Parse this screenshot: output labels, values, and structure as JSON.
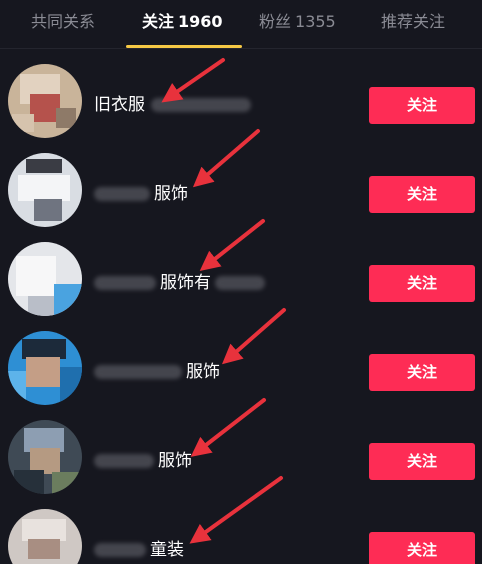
{
  "tabs": [
    {
      "label": "共同关系",
      "count": ""
    },
    {
      "label": "关注",
      "count": "1960"
    },
    {
      "label": "粉丝",
      "count": "1355"
    },
    {
      "label": "推荐关注",
      "count": ""
    }
  ],
  "accent_colors": {
    "follow_button": "#fe2c55",
    "tab_indicator": "#f6c945",
    "arrow": "#e8323c"
  },
  "follow_list": [
    {
      "name_visible": "旧衣服",
      "avatar_icon": "pixelated-avatar",
      "button": "关注"
    },
    {
      "name_visible": "服饰",
      "avatar_icon": "pixelated-avatar",
      "button": "关注"
    },
    {
      "name_visible": "服饰有",
      "avatar_icon": "pixelated-avatar",
      "button": "关注"
    },
    {
      "name_visible": "服饰",
      "avatar_icon": "pixelated-avatar",
      "button": "关注"
    },
    {
      "name_visible": "服饰",
      "avatar_icon": "pixelated-avatar",
      "button": "关注"
    },
    {
      "name_visible": "童装",
      "avatar_icon": "pixelated-avatar",
      "button": "关注"
    }
  ]
}
